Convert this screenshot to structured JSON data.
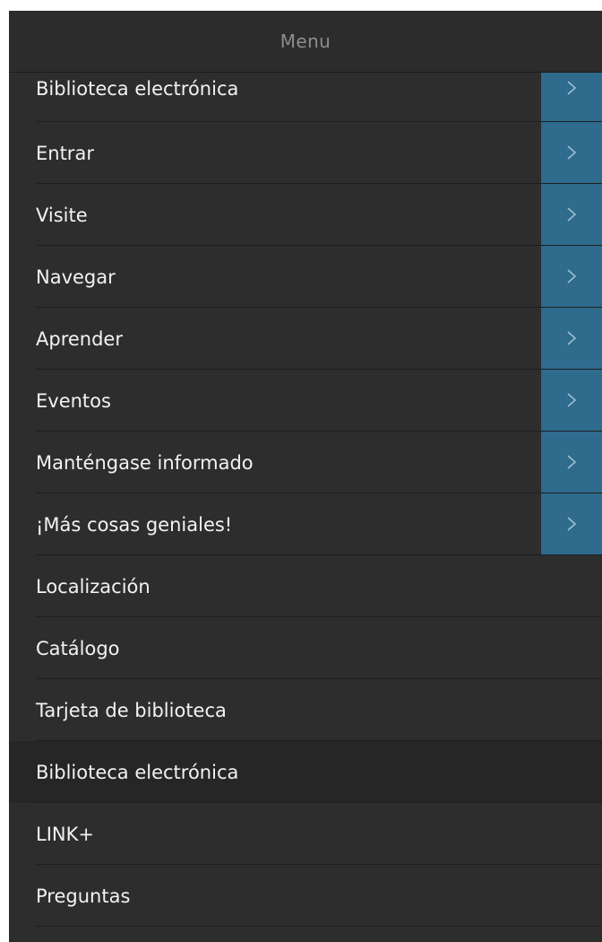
{
  "header": {
    "title": "Menu"
  },
  "menu": {
    "items": [
      {
        "label": "Biblioteca electrónica",
        "has_submenu": true
      },
      {
        "label": "Entrar",
        "has_submenu": true
      },
      {
        "label": "Visite",
        "has_submenu": true
      },
      {
        "label": "Navegar",
        "has_submenu": true
      },
      {
        "label": "Aprender",
        "has_submenu": true
      },
      {
        "label": "Eventos",
        "has_submenu": true
      },
      {
        "label": "Manténgase informado",
        "has_submenu": true
      },
      {
        "label": "¡Más cosas geniales!",
        "has_submenu": true
      },
      {
        "label": "Localización",
        "has_submenu": false
      },
      {
        "label": "Catálogo",
        "has_submenu": false
      },
      {
        "label": "Tarjeta de biblioteca",
        "has_submenu": false
      },
      {
        "label": "Biblioteca electrónica",
        "has_submenu": false,
        "active": true
      },
      {
        "label": "LINK+",
        "has_submenu": false
      },
      {
        "label": "Preguntas",
        "has_submenu": false
      }
    ]
  },
  "colors": {
    "background": "#2d2d2d",
    "submenu_toggle": "#2e6b8c",
    "active_item": "#262626",
    "text": "#f2f2f2",
    "header_text": "#8d8d8d"
  },
  "icons": {
    "submenu_toggle": "chevron-right-icon"
  }
}
